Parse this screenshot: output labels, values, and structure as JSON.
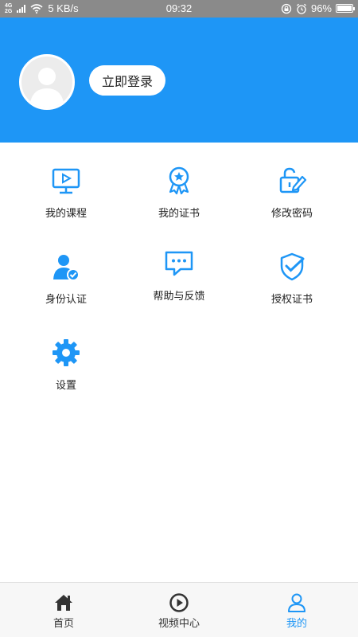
{
  "status_bar": {
    "network_type": "4G",
    "network_type_2": "2G",
    "speed": "5 KB/s",
    "time": "09:32",
    "battery": "96%"
  },
  "header": {
    "login_button": "立即登录",
    "accent_color": "#1e96f6"
  },
  "menu": [
    {
      "label": "我的课程",
      "icon": "monitor-play-icon"
    },
    {
      "label": "我的证书",
      "icon": "medal-icon"
    },
    {
      "label": "修改密码",
      "icon": "lock-edit-icon"
    },
    {
      "label": "身份认证",
      "icon": "user-verified-icon"
    },
    {
      "label": "帮助与反馈",
      "icon": "chat-bubble-icon"
    },
    {
      "label": "授权证书",
      "icon": "shield-check-icon"
    },
    {
      "label": "设置",
      "icon": "gear-icon"
    }
  ],
  "tabbar": {
    "items": [
      {
        "label": "首页",
        "icon": "home-icon"
      },
      {
        "label": "视频中心",
        "icon": "play-circle-icon"
      },
      {
        "label": "我的",
        "icon": "user-icon"
      }
    ],
    "active_color": "#1e96f6",
    "inactive_color": "#333333"
  }
}
